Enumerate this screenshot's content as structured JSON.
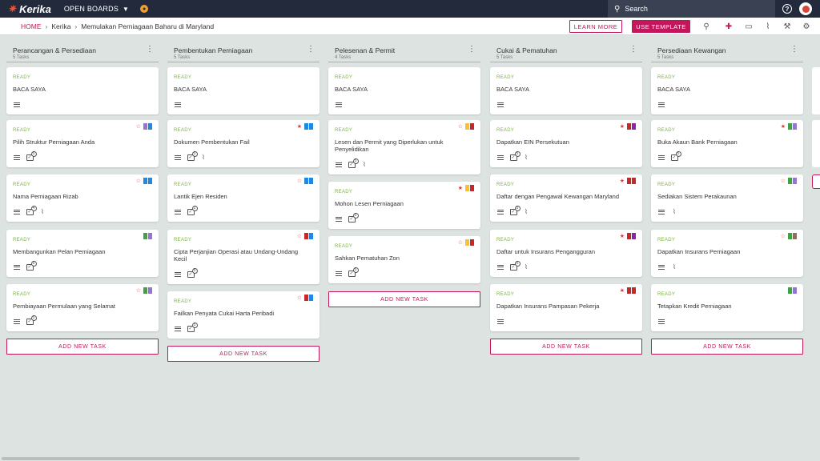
{
  "topbar": {
    "logo_text": "Kerika",
    "open_boards_label": "OPEN BOARDS",
    "search_label": "Search",
    "help_glyph": "?"
  },
  "subbar": {
    "breadcrumb_home": "HOME",
    "breadcrumb_kerika": "Kerika",
    "breadcrumb_board": "Memulakan Perniagaan Baharu di Maryland",
    "learn_more_label": "LEARN MORE",
    "use_template_label": "USE TEMPLATE",
    "tools": [
      "search-icon",
      "add-person-icon",
      "chat-icon",
      "attachment-icon",
      "wrench-icon",
      "settings-icon"
    ]
  },
  "colors": {
    "accent": "#c2185b",
    "ready": "#7cb342",
    "topbar": "#232a3c",
    "background": "#dde3e1"
  },
  "add_task_label": "ADD NEW TASK",
  "columns": [
    {
      "title": "Perancangan & Persediaan",
      "count": "5 Tasks",
      "cards": [
        {
          "status": "READY",
          "title": "BACA SAYA",
          "star": "",
          "flags": [],
          "icons": [
            "lines"
          ]
        },
        {
          "status": "READY",
          "title": "Pilih Struktur Perniagaan Anda",
          "star": "outline",
          "flags": [
            "#9575cd",
            "#1e88e5"
          ],
          "icons": [
            "lines",
            "check"
          ],
          "check_count": "5"
        },
        {
          "status": "READY",
          "title": "Nama Perniagaan Rizab",
          "star": "outline",
          "flags": [
            "#1e88e5",
            "#1e88e5"
          ],
          "icons": [
            "lines",
            "check",
            "clip"
          ],
          "check_count": "4"
        },
        {
          "status": "READY",
          "title": "Membangunkan Pelan Perniagaan",
          "star": "",
          "flags": [
            "#43a047",
            "#9575cd"
          ],
          "icons": [
            "lines",
            "check"
          ],
          "check_count": "5"
        },
        {
          "status": "READY",
          "title": "Pembiayaan Permulaan yang Selamat",
          "star": "outline",
          "flags": [
            "#43a047",
            "#9575cd"
          ],
          "icons": [
            "lines",
            "check"
          ],
          "check_count": "5"
        }
      ]
    },
    {
      "title": "Pembentukan Perniagaan",
      "count": "5 Tasks",
      "cards": [
        {
          "status": "READY",
          "title": "BACA SAYA",
          "star": "",
          "flags": [],
          "icons": [
            "lines"
          ]
        },
        {
          "status": "READY",
          "title": "Dokumen Pembentukan Fail",
          "star": "filled",
          "flags": [
            "#1e88e5",
            "#1e88e5"
          ],
          "icons": [
            "lines",
            "check",
            "clip"
          ],
          "check_count": "5"
        },
        {
          "status": "READY",
          "title": "Lantik Ejen Residen",
          "star": "outline",
          "flags": [
            "#1e88e5",
            "#1e88e5"
          ],
          "icons": [
            "lines",
            "check"
          ],
          "check_count": "2"
        },
        {
          "status": "READY",
          "title": "Cipta Perjanjian Operasi atau Undang-Undang Kecil",
          "star": "outline",
          "flags": [
            "#c62828",
            "#1e88e5"
          ],
          "icons": [
            "lines",
            "check"
          ],
          "check_count": "5"
        },
        {
          "status": "READY",
          "title": "Failkan Penyata Cukai Harta Peribadi",
          "star": "outline",
          "flags": [
            "#c62828",
            "#1e88e5"
          ],
          "icons": [
            "lines",
            "check"
          ],
          "check_count": "5"
        }
      ]
    },
    {
      "title": "Pelesenan & Permit",
      "count": "4 Tasks",
      "cards": [
        {
          "status": "READY",
          "title": "BACA SAYA",
          "star": "",
          "flags": [],
          "icons": [
            "lines"
          ]
        },
        {
          "status": "READY",
          "title": "Lesen dan Permit yang Diperlukan untuk Penyelidikan",
          "star": "outline",
          "flags": [
            "#fbc02d",
            "#c62828"
          ],
          "icons": [
            "lines",
            "check",
            "clip"
          ],
          "check_count": "5"
        },
        {
          "status": "READY",
          "title": "Mohon Lesen Perniagaan",
          "star": "filled",
          "flags": [
            "#fbc02d",
            "#c62828"
          ],
          "icons": [
            "lines",
            "check"
          ],
          "check_count": "5"
        },
        {
          "status": "READY",
          "title": "Sahkan Pematuhan Zon",
          "star": "outline",
          "flags": [
            "#fbc02d",
            "#c62828"
          ],
          "icons": [
            "lines",
            "check"
          ],
          "check_count": "5"
        }
      ]
    },
    {
      "title": "Cukai & Pematuhan",
      "count": "5 Tasks",
      "cards": [
        {
          "status": "READY",
          "title": "BACA SAYA",
          "star": "",
          "flags": [],
          "icons": [
            "lines"
          ]
        },
        {
          "status": "READY",
          "title": "Dapatkan EIN Persekutuan",
          "star": "filled",
          "flags": [
            "#c62828",
            "#8e24aa"
          ],
          "icons": [
            "lines",
            "check",
            "clip"
          ],
          "check_count": "5"
        },
        {
          "status": "READY",
          "title": "Daftar dengan Pengawal Kewangan Maryland",
          "star": "filled",
          "flags": [
            "#c62828",
            "#c62828"
          ],
          "icons": [
            "lines",
            "check",
            "clip"
          ],
          "check_count": "5"
        },
        {
          "status": "READY",
          "title": "Daftar untuk Insurans Pengangguran",
          "star": "filled",
          "flags": [
            "#c62828",
            "#8e24aa"
          ],
          "icons": [
            "lines",
            "check",
            "clip"
          ],
          "check_count": "5"
        },
        {
          "status": "READY",
          "title": "Dapatkan Insurans Pampasan Pekerja",
          "star": "filled",
          "flags": [
            "#c62828",
            "#c62828"
          ],
          "icons": [
            "lines"
          ]
        }
      ]
    },
    {
      "title": "Persediaan Kewangan",
      "count": "5 Tasks",
      "cards": [
        {
          "status": "READY",
          "title": "BACA SAYA",
          "star": "",
          "flags": [],
          "icons": [
            "lines"
          ]
        },
        {
          "status": "READY",
          "title": "Buka Akaun Bank Perniagaan",
          "star": "filled",
          "flags": [
            "#43a047",
            "#9575cd"
          ],
          "icons": [
            "lines",
            "check"
          ],
          "check_count": "5"
        },
        {
          "status": "READY",
          "title": "Sediakan Sistem Perakaunan",
          "star": "outline",
          "flags": [
            "#43a047",
            "#9575cd"
          ],
          "icons": [
            "lines",
            "clip"
          ]
        },
        {
          "status": "READY",
          "title": "Dapatkan Insurans Perniagaan",
          "star": "outline",
          "flags": [
            "#43a047",
            "#8d6e63"
          ],
          "icons": [
            "lines",
            "clip"
          ]
        },
        {
          "status": "READY",
          "title": "Tetapkan Kredit Perniagaan",
          "star": "",
          "flags": [
            "#43a047",
            "#9575cd"
          ],
          "icons": [
            "lines"
          ]
        }
      ]
    }
  ]
}
